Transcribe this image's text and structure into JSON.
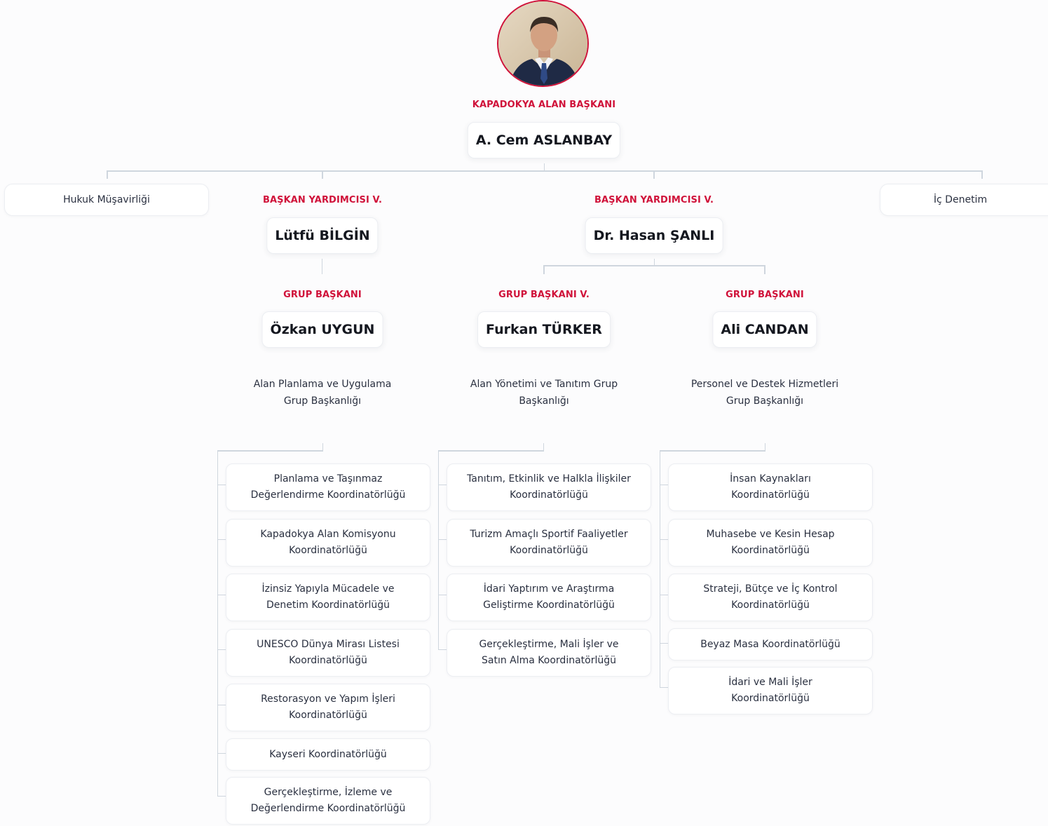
{
  "president": {
    "role": "KAPADOKYA ALAN BAŞKANI",
    "name": "A. Cem ASLANBAY"
  },
  "side_units": {
    "left": "Hukuk Müşavirliği",
    "right": "İç Denetim"
  },
  "vice_presidents": [
    {
      "role": "BAŞKAN YARDIMCISI V.",
      "name": "Lütfü BİLGİN"
    },
    {
      "role": "BAŞKAN YARDIMCISI V.",
      "name": "Dr. Hasan ŞANLI"
    }
  ],
  "groups": [
    {
      "role": "GRUP BAŞKANI",
      "name": "Özkan UYGUN",
      "department": [
        "Alan Planlama ve Uygulama",
        "Grup Başkanlığı"
      ],
      "units": [
        [
          "Planlama ve Taşınmaz",
          "Değerlendirme Koordinatörlüğü"
        ],
        [
          "Kapadokya Alan Komisyonu",
          "Koordinatörlüğü"
        ],
        [
          "İzinsiz Yapıyla Mücadele ve",
          "Denetim Koordinatörlüğü"
        ],
        [
          "UNESCO Dünya Mirası Listesi",
          "Koordinatörlüğü"
        ],
        [
          "Restorasyon ve Yapım İşleri",
          "Koordinatörlüğü"
        ],
        [
          "Kayseri Koordinatörlüğü"
        ],
        [
          "Gerçekleştirme, İzleme ve",
          "Değerlendirme Koordinatörlüğü"
        ]
      ]
    },
    {
      "role": "GRUP BAŞKANI V.",
      "name": "Furkan TÜRKER",
      "department": [
        "Alan Yönetimi ve Tanıtım Grup",
        "Başkanlığı"
      ],
      "units": [
        [
          "Tanıtım, Etkinlik ve Halkla İlişkiler",
          "Koordinatörlüğü"
        ],
        [
          "Turizm Amaçlı Sportif Faaliyetler",
          "Koordinatörlüğü"
        ],
        [
          "İdari Yaptırım ve Araştırma",
          "Geliştirme Koordinatörlüğü"
        ],
        [
          "Gerçekleştirme, Mali İşler ve",
          "Satın Alma Koordinatörlüğü"
        ]
      ]
    },
    {
      "role": "GRUP BAŞKANI",
      "name": "Ali CANDAN",
      "department": [
        "Personel ve Destek Hizmetleri",
        "Grup Başkanlığı"
      ],
      "units": [
        [
          "İnsan Kaynakları",
          "Koordinatörlüğü"
        ],
        [
          "Muhasebe ve Kesin Hesap",
          "Koordinatörlüğü"
        ],
        [
          "Strateji, Bütçe ve İç Kontrol",
          "Koordinatörlüğü"
        ],
        [
          "Beyaz Masa Koordinatörlüğü"
        ],
        [
          "İdari ve Mali İşler",
          "Koordinatörlüğü"
        ]
      ]
    }
  ]
}
